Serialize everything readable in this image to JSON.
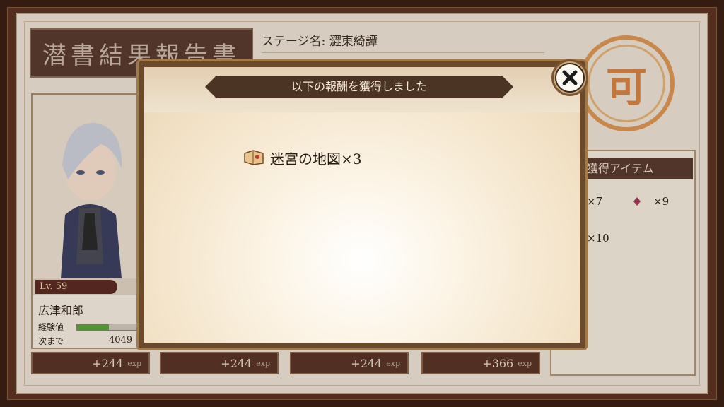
{
  "report": {
    "title": "潜書結果報告書",
    "stage_label": "ステージ名: 澀東綺譚",
    "stamp": "可"
  },
  "character": {
    "level": "Lv. 59",
    "name": "広津和郎",
    "exp_label": "経験値",
    "exp_progress": 0.5,
    "next_label": "次まで",
    "next_value": "4049"
  },
  "exp_gains": [
    {
      "amount": "+244",
      "unit": "exp"
    },
    {
      "amount": "+244",
      "unit": "exp"
    },
    {
      "amount": "+244",
      "unit": "exp"
    },
    {
      "amount": "+366",
      "unit": "exp"
    }
  ],
  "items_panel": {
    "header": "獲得アイテム",
    "entries": [
      "×7",
      "×9",
      "×10"
    ]
  },
  "modal": {
    "title": "以下の報酬を獲得しました",
    "reward": "迷宮の地図×3",
    "reward_icon": "map-scroll-icon",
    "close_icon": "close-icon"
  },
  "colors": {
    "accent": "#d1722a",
    "banner": "#4b3424",
    "paper": "#e9dfd1"
  }
}
